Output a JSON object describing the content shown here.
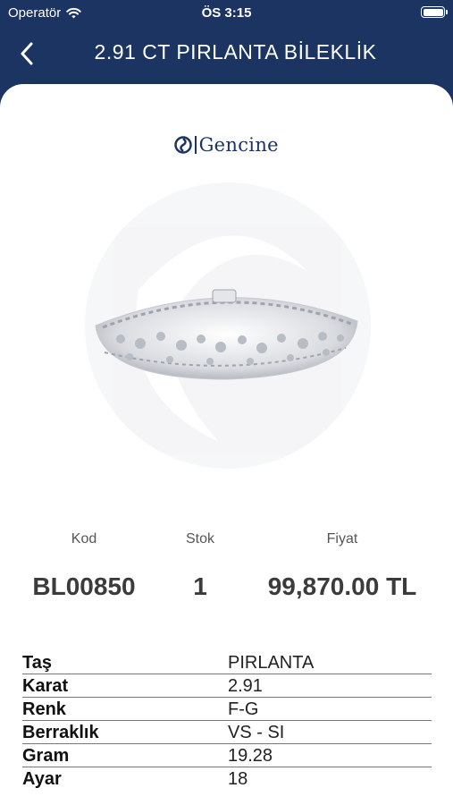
{
  "status": {
    "carrier": "Operatör",
    "time": "ÖS 3:15"
  },
  "nav": {
    "title": "2.91 CT PIRLANTA BİLEKLİK"
  },
  "brand": {
    "name": "Gencine",
    "color": "#1b3461"
  },
  "product": {
    "code_label": "Kod",
    "code": "BL00850",
    "stock_label": "Stok",
    "stock": "1",
    "price_label": "Fiyat",
    "price": "99,870.00 TL"
  },
  "specs": [
    {
      "key": "Taş",
      "value": "PIRLANTA"
    },
    {
      "key": "Karat",
      "value": "2.91"
    },
    {
      "key": "Renk",
      "value": "F-G"
    },
    {
      "key": "Berraklık",
      "value": "VS - SI"
    },
    {
      "key": "Gram",
      "value": "19.28"
    },
    {
      "key": "Ayar",
      "value": "18"
    }
  ],
  "colors": {
    "header": "#1b3461",
    "sheet": "#ffffff",
    "text": "#3b3b3b"
  },
  "icons": {
    "back": "chevron-left-icon",
    "wifi": "wifi-icon",
    "battery": "battery-icon",
    "logo": "gencine-logo-icon"
  }
}
